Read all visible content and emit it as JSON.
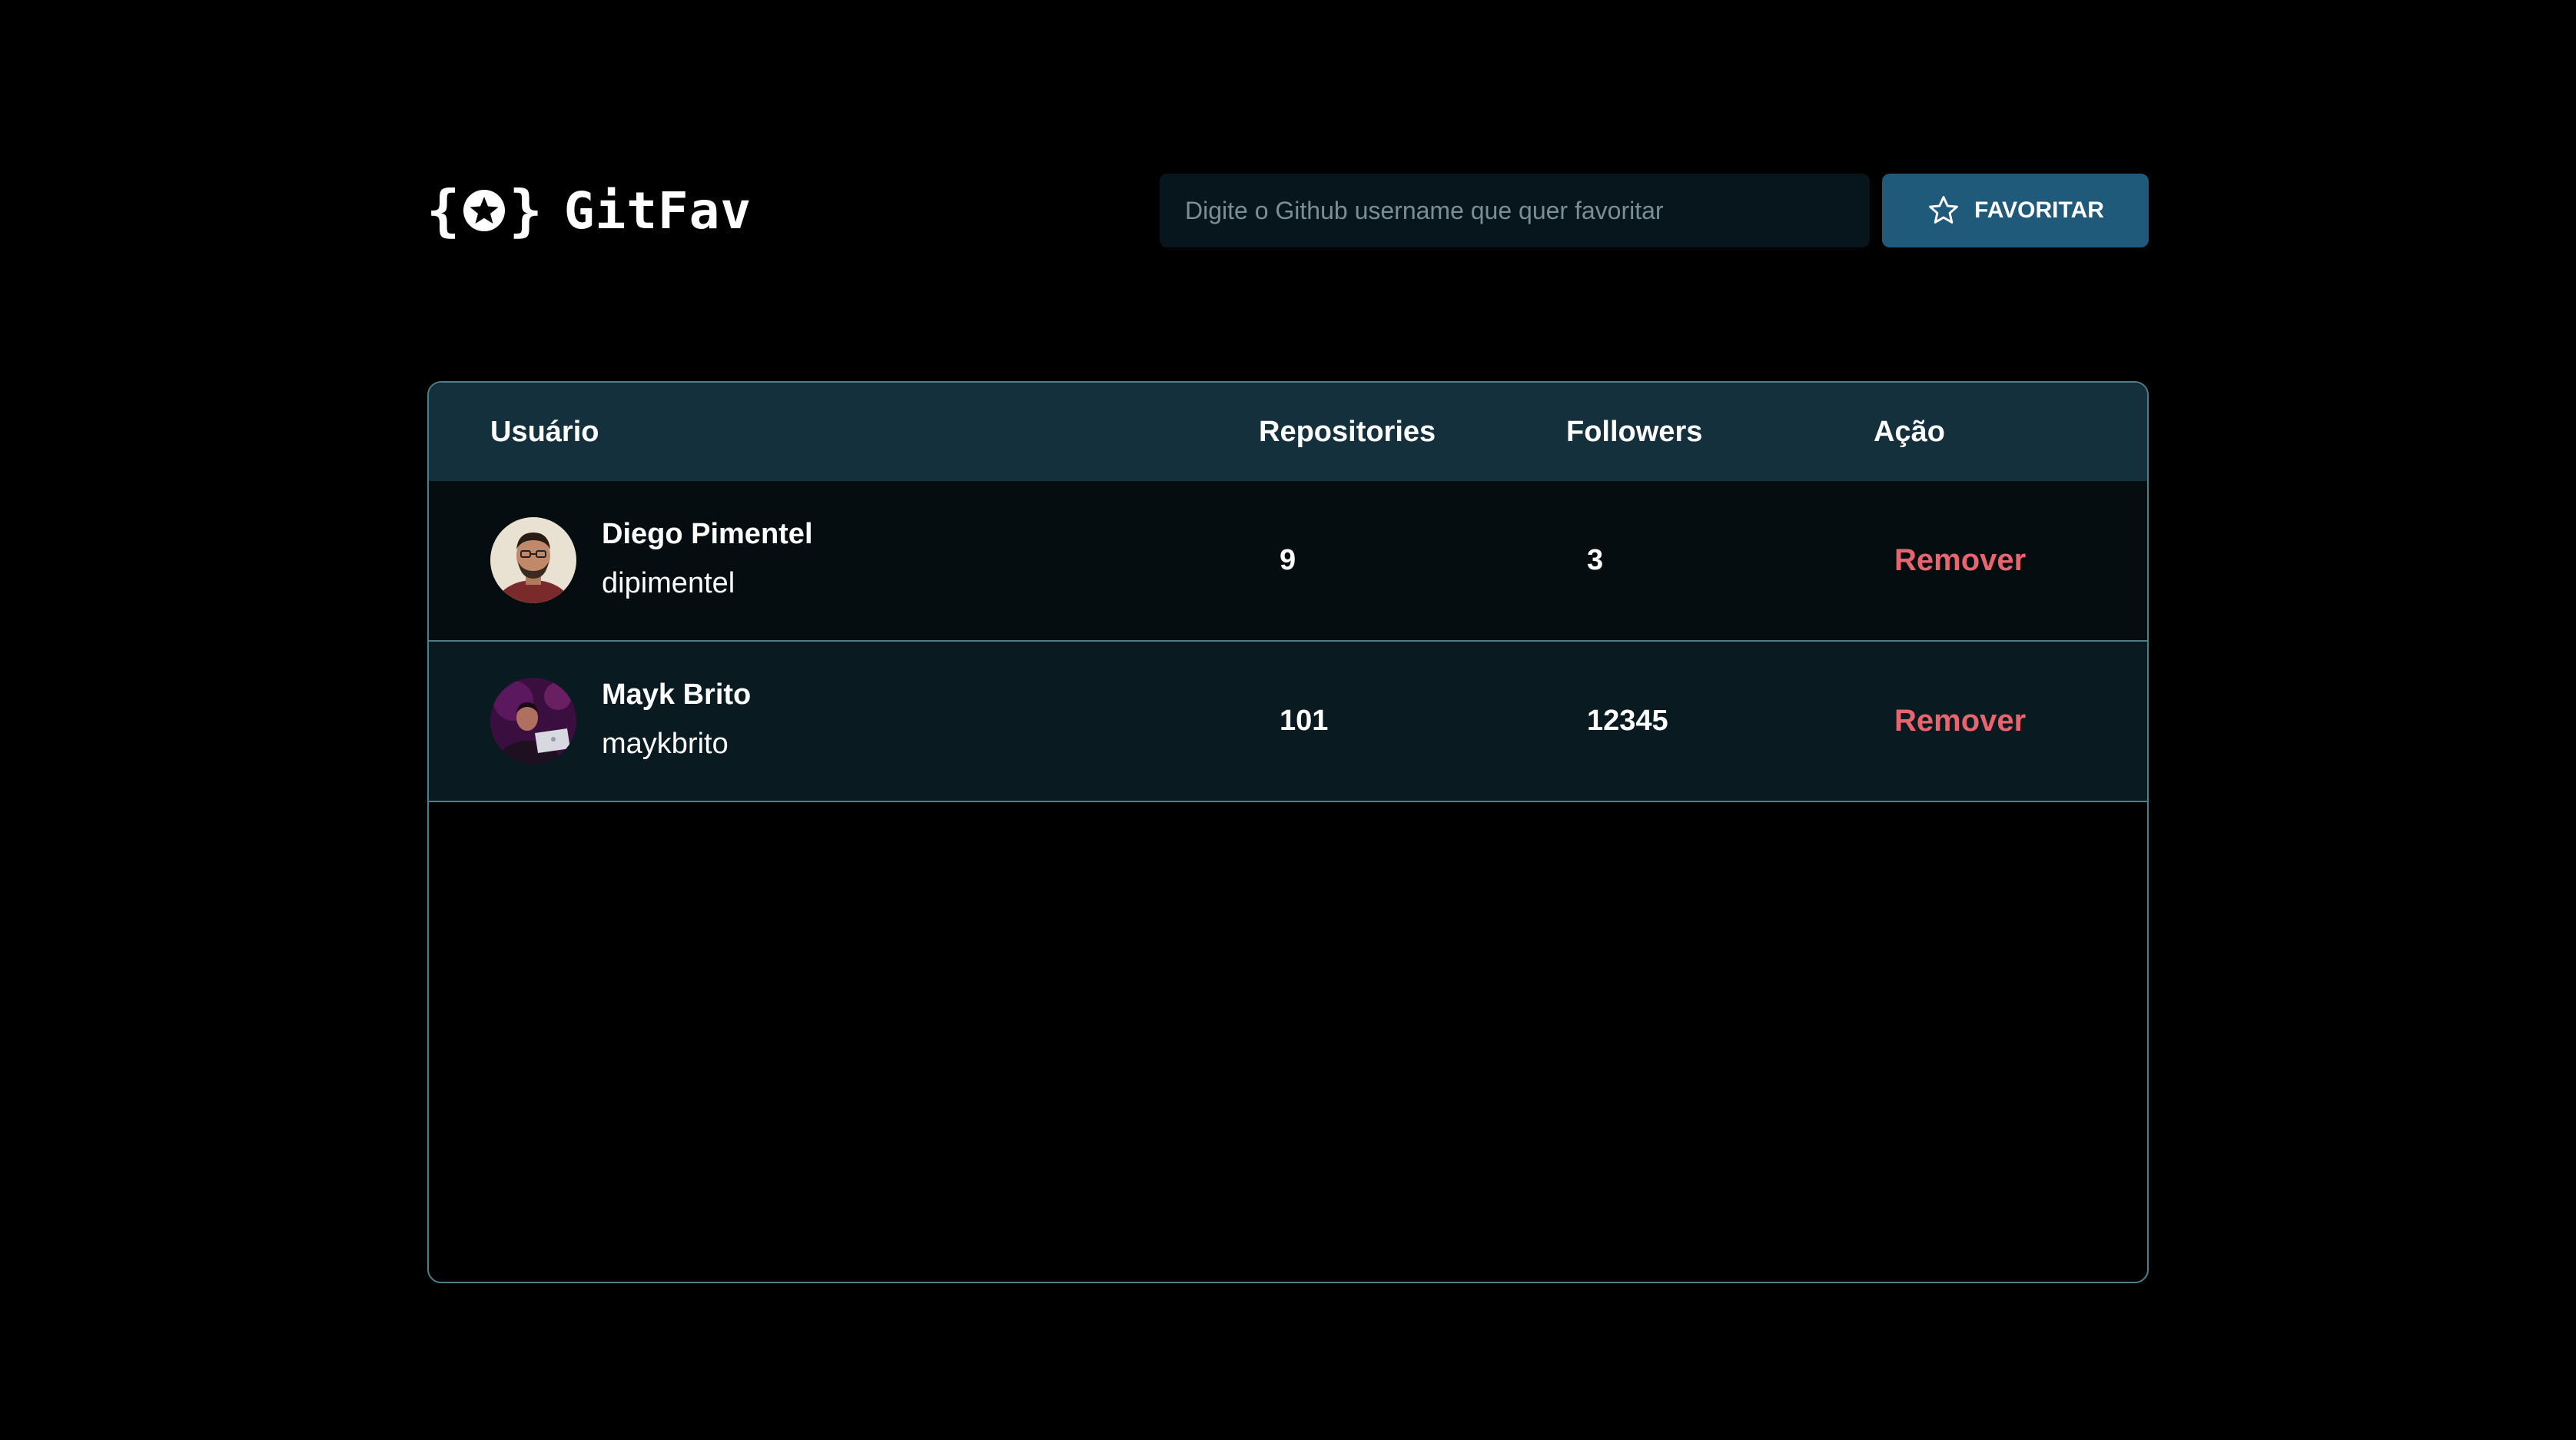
{
  "app": {
    "logo_text": "GitFav"
  },
  "search": {
    "placeholder": "Digite o Github username que quer favoritar",
    "value": ""
  },
  "favorite_button": {
    "label": "FAVORITAR",
    "icon": "star-outline-icon"
  },
  "table": {
    "headers": {
      "user": "Usuário",
      "repositories": "Repositories",
      "followers": "Followers",
      "action": "Ação"
    },
    "rows": [
      {
        "name": "Diego Pimentel",
        "login": "dipimentel",
        "repositories": "9",
        "followers": "3",
        "action": "Remover"
      },
      {
        "name": "Mayk Brito",
        "login": "maykbrito",
        "repositories": "101",
        "followers": "12345",
        "action": "Remover"
      }
    ]
  },
  "colors": {
    "background": "#000000",
    "header_row": "#15303d",
    "button": "#1f5a7a",
    "remove": "#e7656e",
    "border": "#4a808c"
  }
}
